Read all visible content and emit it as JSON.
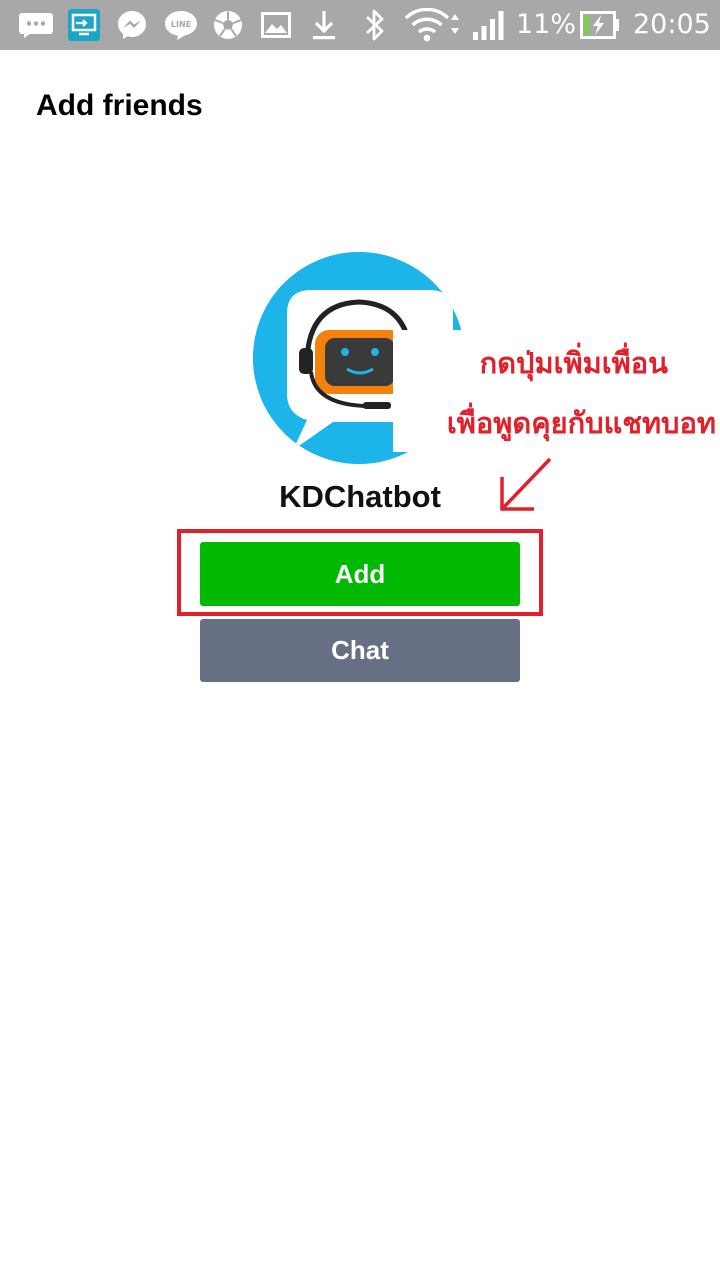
{
  "status_bar": {
    "icons": [
      "chat-bubble-icon",
      "screen-cast-icon",
      "messenger-icon",
      "line-icon",
      "soccer-ball-icon",
      "gallery-icon",
      "download-icon",
      "bluetooth-icon",
      "wifi-icon",
      "signal-icon",
      "battery-charging-icon"
    ],
    "line_icon_text": "LINE",
    "battery_percent": "11%",
    "time": "20:05"
  },
  "header": {
    "title": "Add friends"
  },
  "profile": {
    "name": "KDChatbot",
    "avatar_icon": "chatbot-avatar-icon"
  },
  "actions": {
    "add_label": "Add",
    "chat_label": "Chat"
  },
  "annotation": {
    "line1": "กดปุ่มเพิ่มเพื่อน",
    "line2": "เพื่อพูดคุยกับแชทบอท",
    "color": "#e0212b"
  },
  "colors": {
    "add_button": "#00b900",
    "chat_button": "#676f85",
    "avatar_bg": "#1db4ea",
    "status_bar": "#a8a8a8"
  }
}
